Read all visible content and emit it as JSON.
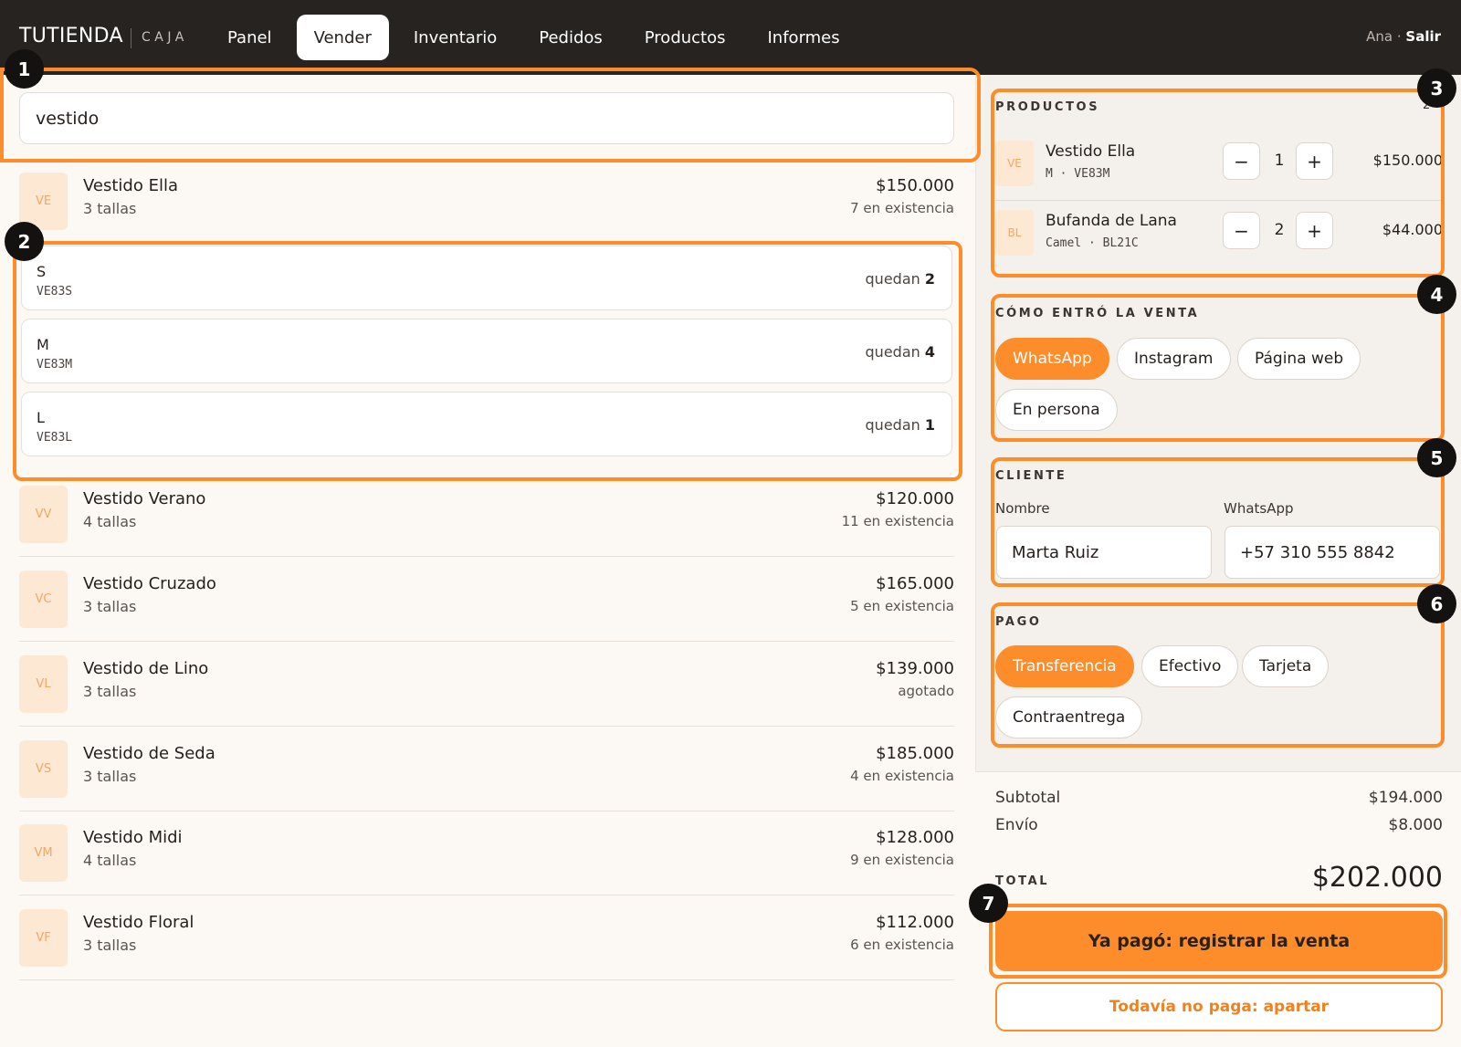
{
  "brand": {
    "name": "TUTIENDA",
    "sub": "CAJA"
  },
  "nav": {
    "tabs": [
      "Panel",
      "Vender",
      "Inventario",
      "Pedidos",
      "Productos",
      "Informes"
    ],
    "active": "Vender"
  },
  "user": {
    "name": "Ana",
    "sep": "·",
    "logout": "Salir"
  },
  "search": {
    "value": "vestido"
  },
  "results": [
    {
      "initials": "VE",
      "name": "Vestido Ella",
      "sub": "3 tallas",
      "price": "$150.000",
      "stock": "7 en existencia"
    },
    {
      "initials": "VV",
      "name": "Vestido Verano",
      "sub": "4 tallas",
      "price": "$120.000",
      "stock": "11 en existencia"
    },
    {
      "initials": "VC",
      "name": "Vestido Cruzado",
      "sub": "3 tallas",
      "price": "$165.000",
      "stock": "5 en existencia"
    },
    {
      "initials": "VL",
      "name": "Vestido de Lino",
      "sub": "3 tallas",
      "price": "$139.000",
      "stock": "agotado"
    },
    {
      "initials": "VS",
      "name": "Vestido de Seda",
      "sub": "3 tallas",
      "price": "$185.000",
      "stock": "4 en existencia"
    },
    {
      "initials": "VM",
      "name": "Vestido Midi",
      "sub": "4 tallas",
      "price": "$128.000",
      "stock": "9 en existencia"
    },
    {
      "initials": "VF",
      "name": "Vestido Floral",
      "sub": "3 tallas",
      "price": "$112.000",
      "stock": "6 en existencia"
    }
  ],
  "variants": [
    {
      "size": "S",
      "sku": "VE83S",
      "left_label": "quedan",
      "left_count": "2"
    },
    {
      "size": "M",
      "sku": "VE83M",
      "left_label": "quedan",
      "left_count": "4"
    },
    {
      "size": "L",
      "sku": "VE83L",
      "left_label": "quedan",
      "left_count": "1"
    }
  ],
  "cart": {
    "label": "PRODUCTOS",
    "count": "2",
    "items": [
      {
        "initials": "VE",
        "name": "Vestido Ella",
        "meta": "M · VE83M",
        "qty": "1",
        "price": "$150.000"
      },
      {
        "initials": "BL",
        "name": "Bufanda de Lana",
        "meta": "Camel · BL21C",
        "qty": "2",
        "price": "$44.000"
      }
    ],
    "minus": "−",
    "plus": "+"
  },
  "channel": {
    "label": "CÓMO ENTRÓ LA VENTA",
    "options": [
      "WhatsApp",
      "Instagram",
      "Página web",
      "En persona"
    ],
    "selected": "WhatsApp"
  },
  "customer": {
    "label": "CLIENTE",
    "name_label": "Nombre",
    "name_value": "Marta Ruiz",
    "phone_label": "WhatsApp",
    "phone_value": "+57 310 555 8842"
  },
  "payment": {
    "label": "PAGO",
    "options": [
      "Transferencia",
      "Efectivo",
      "Tarjeta",
      "Contraentrega"
    ],
    "selected": "Transferencia"
  },
  "totals": {
    "subtotal_label": "Subtotal",
    "subtotal": "$194.000",
    "shipping_label": "Envío",
    "shipping": "$8.000",
    "total_label": "TOTAL",
    "total": "$202.000"
  },
  "actions": {
    "primary": "Ya pagó: registrar la venta",
    "secondary": "Todavía no paga: apartar"
  },
  "annotations": [
    "1",
    "2",
    "3",
    "4",
    "5",
    "6",
    "7"
  ],
  "colors": {
    "accent": "#fd8d2b",
    "topbar": "#272320",
    "thumb_bg": "#fde8d3"
  }
}
